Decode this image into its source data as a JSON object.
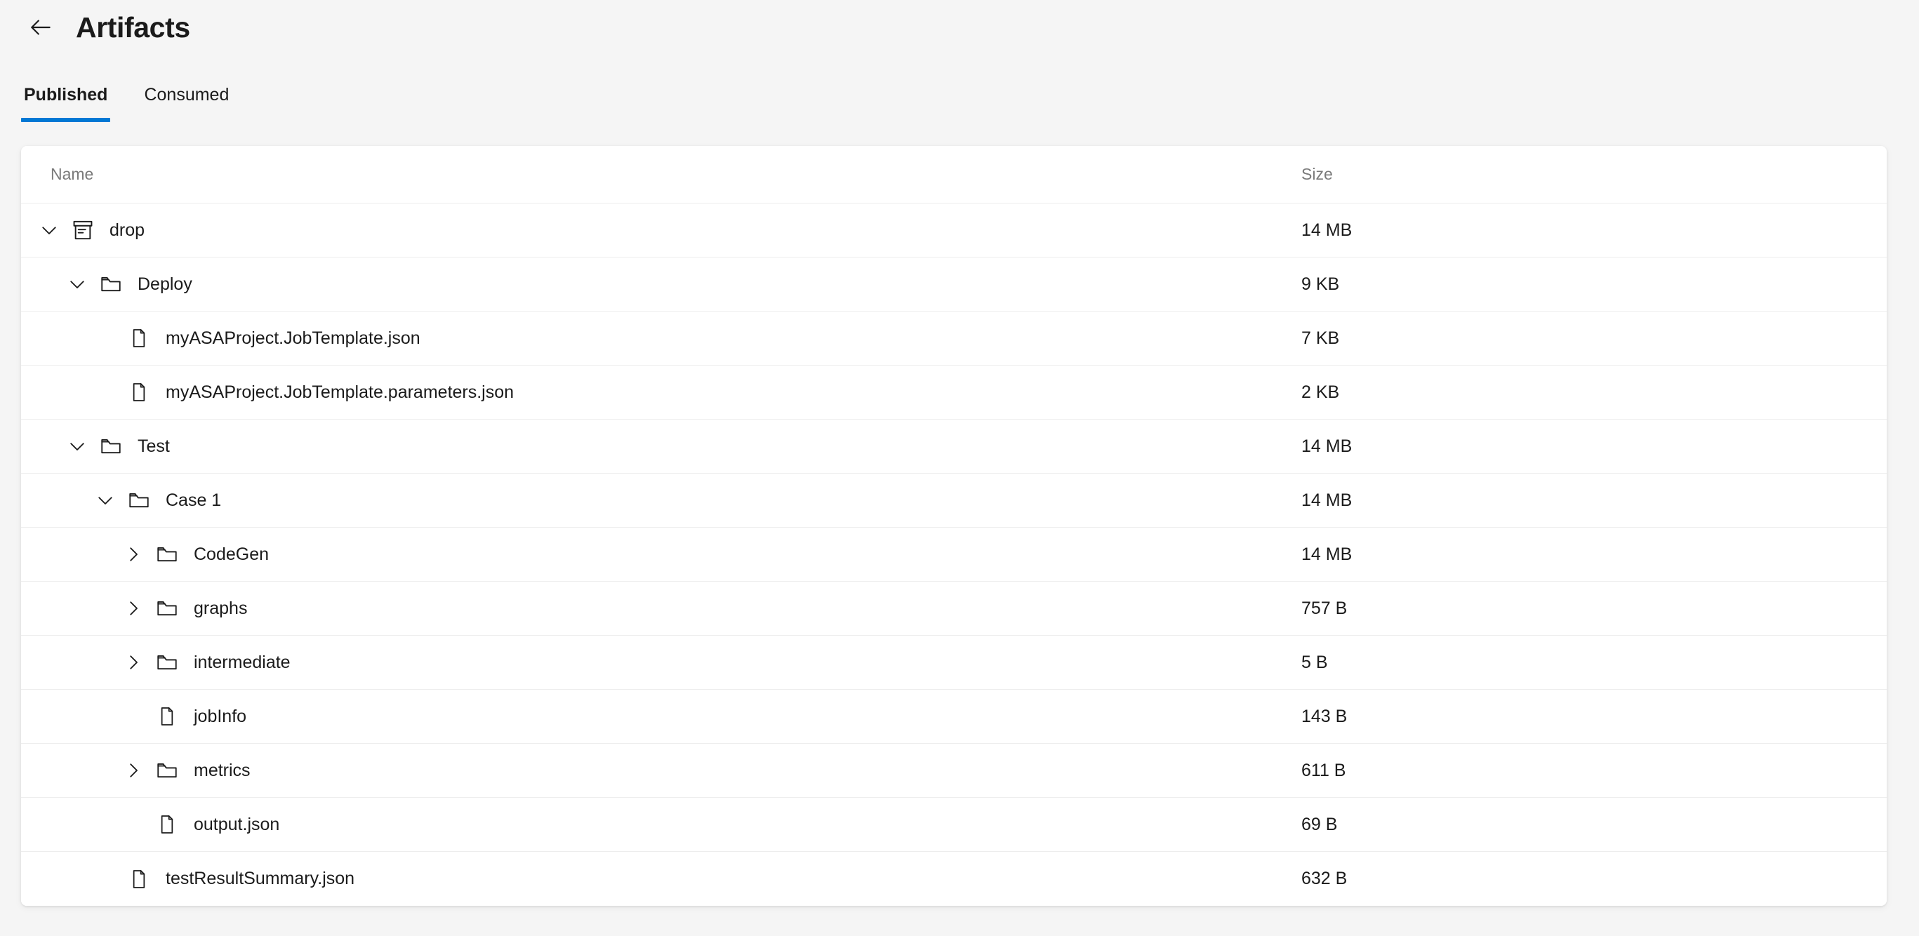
{
  "header": {
    "back_icon": "arrow-left-icon",
    "title": "Artifacts"
  },
  "tabs": [
    {
      "label": "Published",
      "active": true
    },
    {
      "label": "Consumed",
      "active": false
    }
  ],
  "table": {
    "columns": {
      "name": "Name",
      "size": "Size"
    },
    "rows": [
      {
        "name": "drop",
        "size": "14 MB",
        "icon": "archive-icon",
        "indent": 0,
        "expandable": true,
        "expanded": true
      },
      {
        "name": "Deploy",
        "size": "9 KB",
        "icon": "folder-icon",
        "indent": 1,
        "expandable": true,
        "expanded": true
      },
      {
        "name": "myASAProject.JobTemplate.json",
        "size": "7 KB",
        "icon": "file-icon",
        "indent": 2,
        "expandable": false,
        "expanded": false
      },
      {
        "name": "myASAProject.JobTemplate.parameters.json",
        "size": "2 KB",
        "icon": "file-icon",
        "indent": 2,
        "expandable": false,
        "expanded": false
      },
      {
        "name": "Test",
        "size": "14 MB",
        "icon": "folder-icon",
        "indent": 1,
        "expandable": true,
        "expanded": true
      },
      {
        "name": "Case 1",
        "size": "14 MB",
        "icon": "folder-icon",
        "indent": 2,
        "expandable": true,
        "expanded": true
      },
      {
        "name": "CodeGen",
        "size": "14 MB",
        "icon": "folder-icon",
        "indent": 3,
        "expandable": true,
        "expanded": false
      },
      {
        "name": "graphs",
        "size": "757 B",
        "icon": "folder-icon",
        "indent": 3,
        "expandable": true,
        "expanded": false
      },
      {
        "name": "intermediate",
        "size": "5 B",
        "icon": "folder-icon",
        "indent": 3,
        "expandable": true,
        "expanded": false
      },
      {
        "name": "jobInfo",
        "size": "143 B",
        "icon": "file-icon",
        "indent": 3,
        "expandable": false,
        "expanded": false
      },
      {
        "name": "metrics",
        "size": "611 B",
        "icon": "folder-icon",
        "indent": 3,
        "expandable": true,
        "expanded": false
      },
      {
        "name": "output.json",
        "size": "69 B",
        "icon": "file-icon",
        "indent": 3,
        "expandable": false,
        "expanded": false
      },
      {
        "name": "testResultSummary.json",
        "size": "632 B",
        "icon": "file-icon",
        "indent": 2,
        "expandable": false,
        "expanded": false
      }
    ]
  },
  "colors": {
    "accent": "#0078d4",
    "page_background": "#f5f5f5",
    "card_background": "#ffffff",
    "text_primary": "#1b1b1b",
    "text_secondary": "#7a7a7a",
    "row_divider": "#ededed"
  }
}
